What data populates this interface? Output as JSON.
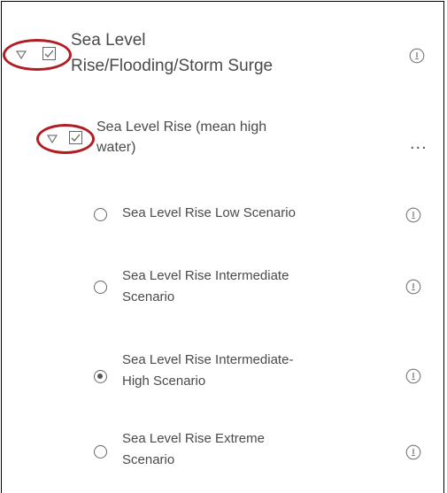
{
  "layers": {
    "group": {
      "title_line1": "Sea Level",
      "title_line2": "Rise/Flooding/Storm Surge",
      "caret_icon": "caret-down-icon",
      "checkbox_icon": "checkbox-checked-icon",
      "info_icon": "info-icon",
      "sublayer": {
        "title_line1": "Sea Level Rise (mean high",
        "title_line2": "water)",
        "options_icon": "more-options-icon",
        "options_label": "...",
        "items": [
          {
            "line1": "Sea Level Rise Low Scenario",
            "line2": "",
            "selected": false
          },
          {
            "line1": "Sea Level Rise Intermediate",
            "line2": "Scenario",
            "selected": false
          },
          {
            "line1": "Sea Level Rise Intermediate-",
            "line2": "High Scenario",
            "selected": true
          },
          {
            "line1": "Sea Level Rise Extreme",
            "line2": "Scenario",
            "selected": false
          }
        ]
      }
    }
  },
  "colors": {
    "text": "#4a4a4a",
    "highlight": "#b01d23",
    "border": "#000000"
  }
}
